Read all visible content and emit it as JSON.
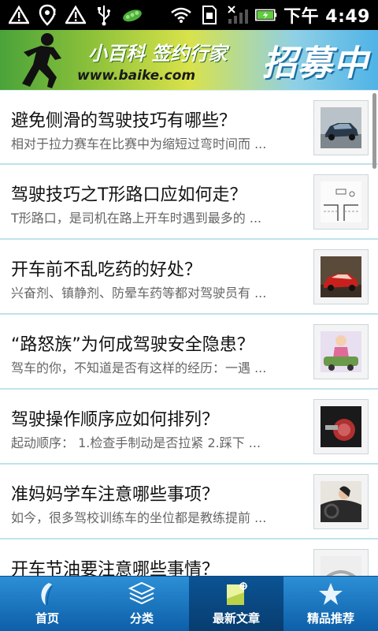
{
  "status_bar": {
    "time": "下午 4:49",
    "icons": [
      "warning-icon",
      "location-icon",
      "warning-icon",
      "usb-icon",
      "peas-icon",
      "wifi-icon",
      "sd-card-icon",
      "signal-off-icon",
      "battery-charging-icon"
    ]
  },
  "banner": {
    "slogan": "小百科 签约行家",
    "url": "www.baike.com",
    "recruit": "招募中"
  },
  "articles": [
    {
      "title": "避免侧滑的驾驶技巧有哪些？",
      "summary": "相对于拉力赛车在比赛中为缩短过弯时间而 ...",
      "thumb": "car-photo"
    },
    {
      "title": "驾驶技巧之T形路口应如何走？",
      "summary": "T形路口，是司机在路上开车时遇到最多的 ...",
      "thumb": "road-diagram"
    },
    {
      "title": "开车前不乱吃药的好处？",
      "summary": "兴奋剂、镇静剂、防晕车药等都对驾驶员有 ...",
      "thumb": "red-car-photo"
    },
    {
      "title": "“路怒族”为何成驾驶安全隐患？",
      "summary": "驾车的你，不知道是否有这样的经历：一遇 ...",
      "thumb": "cartoon-drivers"
    },
    {
      "title": "驾驶操作顺序应如何排列？",
      "summary": "起动顺序： 1.检查手制动是否拉紧 2.踩下 ...",
      "thumb": "car-key-photo"
    },
    {
      "title": "准妈妈学车注意哪些事项？",
      "summary": "如今，很多驾校训练车的坐位都是教练提前 ...",
      "thumb": "driver-photo"
    },
    {
      "title": "开车节油要注意哪些事情？",
      "summary": "",
      "thumb": "silver-car-photo"
    }
  ],
  "tabs": [
    {
      "label": "首页",
      "icon": "leaf-icon",
      "active": false
    },
    {
      "label": "分类",
      "icon": "layers-icon",
      "active": false
    },
    {
      "label": "最新文章",
      "icon": "new-document-icon",
      "active": true
    },
    {
      "label": "精品推荐",
      "icon": "star-icon",
      "active": false
    }
  ],
  "colors": {
    "tab_bar": "#1a78c4",
    "tab_active": "#0b5394",
    "divider": "#bfe3ec"
  }
}
